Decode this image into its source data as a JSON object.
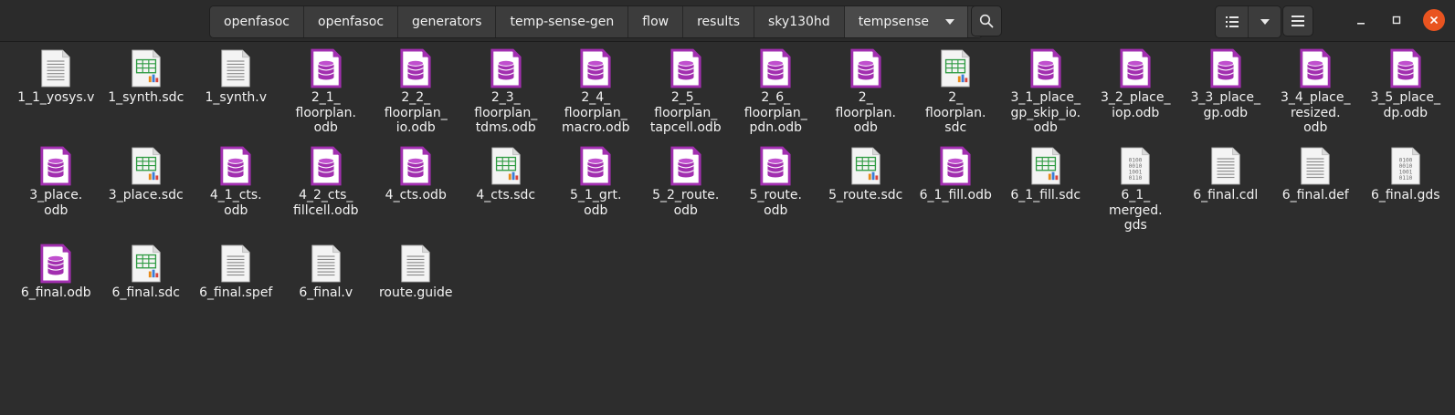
{
  "breadcrumb": [
    "openfasoc",
    "openfasoc",
    "generators",
    "temp-sense-gen",
    "flow",
    "results",
    "sky130hd",
    "tempsense"
  ],
  "icons": {
    "search": "search-icon",
    "list_view": "list-view-icon",
    "view_options": "chevron-down-icon",
    "menu": "hamburger-menu-icon",
    "minimize": "minimize-icon",
    "maximize": "maximize-icon",
    "close": "close-icon"
  },
  "colors": {
    "accent_close": "#e95420",
    "database_icon": "#a22fb0",
    "spreadsheet_icon": "#2e9b42"
  },
  "files": [
    {
      "name": "1_1_yosys.v",
      "type": "text"
    },
    {
      "name": "1_synth.sdc",
      "type": "spreadsheet"
    },
    {
      "name": "1_synth.v",
      "type": "text"
    },
    {
      "name": "2_1_\nfloorplan.\nodb",
      "type": "database"
    },
    {
      "name": "2_2_\nfloorplan_\nio.odb",
      "type": "database"
    },
    {
      "name": "2_3_\nfloorplan_\ntdms.odb",
      "type": "database"
    },
    {
      "name": "2_4_\nfloorplan_\nmacro.odb",
      "type": "database"
    },
    {
      "name": "2_5_\nfloorplan_\ntapcell.odb",
      "type": "database"
    },
    {
      "name": "2_6_\nfloorplan_\npdn.odb",
      "type": "database"
    },
    {
      "name": "2_\nfloorplan.\nodb",
      "type": "database"
    },
    {
      "name": "2_\nfloorplan.\nsdc",
      "type": "spreadsheet"
    },
    {
      "name": "3_1_place_\ngp_skip_io.\nodb",
      "type": "database"
    },
    {
      "name": "3_2_place_\niop.odb",
      "type": "database"
    },
    {
      "name": "3_3_place_\ngp.odb",
      "type": "database"
    },
    {
      "name": "3_4_place_\nresized.\nodb",
      "type": "database"
    },
    {
      "name": "3_5_place_\ndp.odb",
      "type": "database"
    },
    {
      "name": "3_place.\nodb",
      "type": "database"
    },
    {
      "name": "3_place.sdc",
      "type": "spreadsheet"
    },
    {
      "name": "4_1_cts.\nodb",
      "type": "database"
    },
    {
      "name": "4_2_cts_\nfillcell.odb",
      "type": "database"
    },
    {
      "name": "4_cts.odb",
      "type": "database"
    },
    {
      "name": "4_cts.sdc",
      "type": "spreadsheet"
    },
    {
      "name": "5_1_grt.\nodb",
      "type": "database"
    },
    {
      "name": "5_2_route.\nodb",
      "type": "database"
    },
    {
      "name": "5_route.\nodb",
      "type": "database"
    },
    {
      "name": "5_route.sdc",
      "type": "spreadsheet"
    },
    {
      "name": "6_1_fill.odb",
      "type": "database"
    },
    {
      "name": "6_1_fill.sdc",
      "type": "spreadsheet"
    },
    {
      "name": "6_1_\nmerged.\ngds",
      "type": "binary"
    },
    {
      "name": "6_final.cdl",
      "type": "text"
    },
    {
      "name": "6_final.def",
      "type": "text"
    },
    {
      "name": "6_final.gds",
      "type": "binary"
    },
    {
      "name": "6_final.odb",
      "type": "database"
    },
    {
      "name": "6_final.sdc",
      "type": "spreadsheet"
    },
    {
      "name": "6_final.spef",
      "type": "text"
    },
    {
      "name": "6_final.v",
      "type": "text"
    },
    {
      "name": "route.guide",
      "type": "text"
    }
  ],
  "binary_glyph_lines": [
    "0100",
    "0010",
    "1001",
    "0110"
  ]
}
